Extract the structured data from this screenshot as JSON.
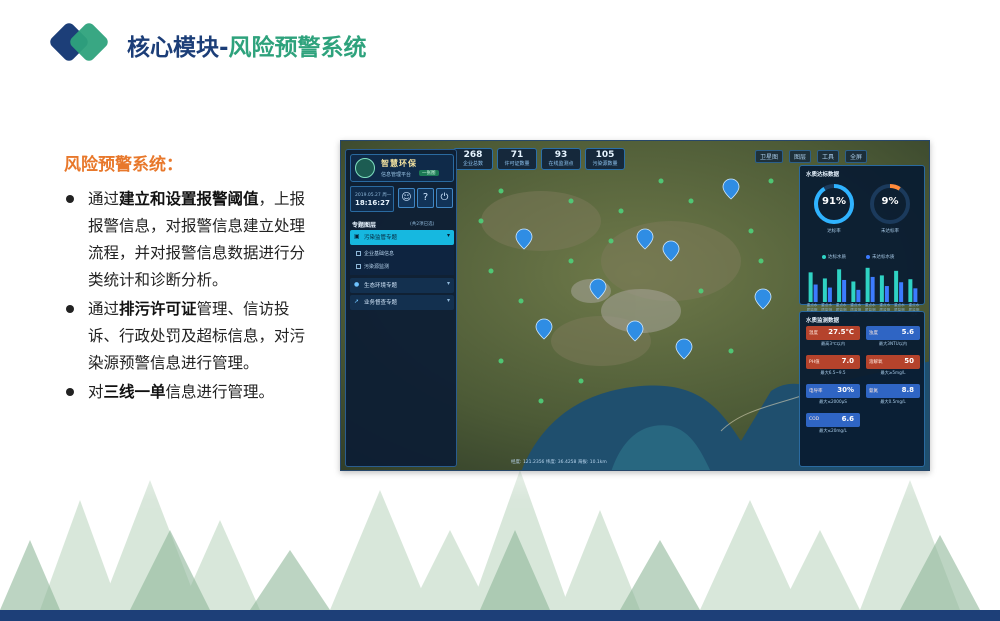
{
  "header": {
    "title_main": "核心模块-",
    "title_accent": "风险预警系统",
    "colors": {
      "navy": "#1c3e78",
      "green": "#2ea27c",
      "orange": "#e8782b"
    }
  },
  "content": {
    "heading": "风险预警系统：",
    "bullets": [
      {
        "pre": "通过",
        "bold": "建立和设置报警阈值",
        "post": "，上报报警信息，对报警信息建立处理流程，并对报警信息数据进行分类统计和诊断分析。"
      },
      {
        "pre": "通过",
        "bold": "排污许可证",
        "post": "管理、信访投诉、行政处罚及超标信息，对污染源预警信息进行管理。"
      },
      {
        "pre": "对",
        "bold": "三线一单",
        "post": "信息进行管理。"
      }
    ]
  },
  "screenshot": {
    "top_stats": [
      {
        "value": "268",
        "label": "企业总数"
      },
      {
        "value": "71",
        "label": "许可证数量"
      },
      {
        "value": "93",
        "label": "在线监测点"
      },
      {
        "value": "105",
        "label": "污染源数量"
      }
    ],
    "tools": [
      "卫星图",
      "图层",
      "工具",
      "全屏"
    ],
    "left_panel": {
      "brand_name": "智慧环保",
      "brand_sub": "信息管理平台",
      "login_chip": "一张图",
      "date": "2019.05.27 周一",
      "time": "18:16:27",
      "icons": [
        "user-icon",
        "help-icon",
        "power-icon"
      ],
      "layers_heading": "专题图层",
      "layers_note": "(共2项已选)",
      "menu_active": "污染监管专题",
      "submenu": [
        "企业基础信息",
        "污染源监测"
      ],
      "menu_items": [
        "生态环境专题",
        "业务督查专题"
      ]
    },
    "water_quality": {
      "heading": "水质达标数据",
      "gauges": [
        {
          "value": "91%",
          "label": "达标率",
          "percent": 91,
          "color": "#2fb3ff"
        },
        {
          "value": "9%",
          "label": "未达标率",
          "percent": 9,
          "color": "#ff8a3a"
        }
      ],
      "legend": [
        "达标水质",
        "未达标水质"
      ],
      "legend_colors": [
        "#2fd3c4",
        "#3c7bff"
      ],
      "chart_data": {
        "type": "bar",
        "categories": [
          "重点水质监测点1",
          "重点水质监测点2",
          "重点水质监测点3",
          "重点水质监测点4",
          "重点水质监测点5",
          "重点水质监测点6",
          "重点水质监测点7",
          "重点水质监测点8"
        ],
        "series": [
          {
            "name": "达标水质",
            "values": [
              78,
              62,
              86,
              54,
              90,
              70,
              82,
              60
            ]
          },
          {
            "name": "未达标水质",
            "values": [
              46,
              38,
              58,
              32,
              66,
              42,
              52,
              36
            ]
          }
        ],
        "ylim": [
          0,
          100
        ]
      }
    },
    "water_monitor": {
      "heading": "水质监测数据",
      "readings": [
        {
          "label": "温度",
          "value": "27.5℃",
          "std": "最高3℃以内",
          "color": "red"
        },
        {
          "label": "浊度",
          "value": "5.6",
          "std": "最大3NTU以内",
          "color": "blue"
        },
        {
          "label": "PH值",
          "value": "7.0",
          "std": "最大6.5~9.5",
          "color": "red"
        },
        {
          "label": "溶解氧",
          "value": "50",
          "std": "最大≥5mg/L",
          "color": "red"
        },
        {
          "label": "电导率",
          "value": "30%",
          "std": "最大≤2000μS",
          "color": "blue"
        },
        {
          "label": "氨氮",
          "value": "8.8",
          "std": "最大0.5mg/L",
          "color": "blue"
        },
        {
          "label": "COD",
          "value": "6.6",
          "std": "最大≤20mg/L",
          "color": "blue"
        }
      ]
    },
    "map_footer": "经度: 121.2356  纬度: 36.4258  海拔: 10.1km"
  }
}
